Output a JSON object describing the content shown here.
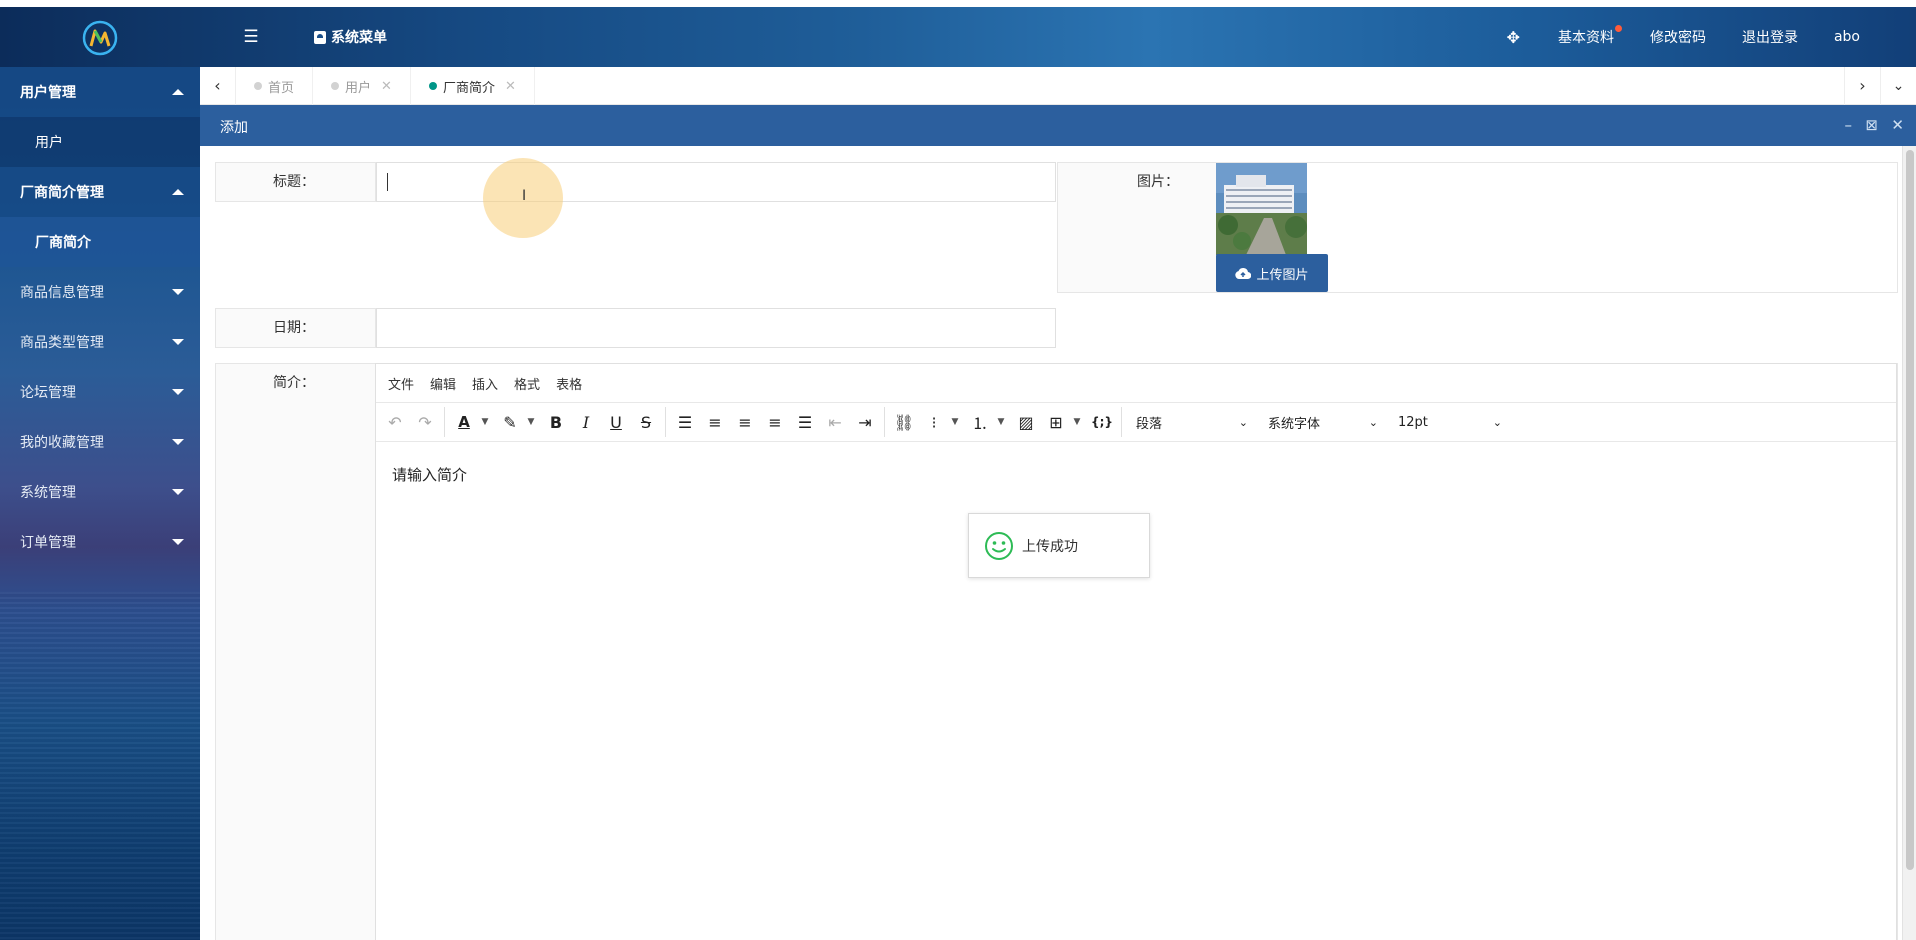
{
  "header": {
    "system_menu_label": "系统菜单",
    "menu_toggle_icon": "list-indent-icon",
    "right_items": [
      {
        "label": "",
        "icon": "fullscreen-icon"
      },
      {
        "label": "基本资料",
        "badge_color": "#ff5b3a"
      },
      {
        "label": "修改密码"
      },
      {
        "label": "退出登录"
      },
      {
        "label": "abo"
      }
    ]
  },
  "sidebar": {
    "items": [
      {
        "label": "用户管理",
        "state": "open"
      },
      {
        "label": "用户",
        "type": "sub"
      },
      {
        "label": "厂商简介管理",
        "state": "open"
      },
      {
        "label": "厂商简介",
        "type": "sub",
        "active": true
      },
      {
        "label": "商品信息管理",
        "state": "closed"
      },
      {
        "label": "商品类型管理",
        "state": "closed"
      },
      {
        "label": "论坛管理",
        "state": "closed"
      },
      {
        "label": "我的收藏管理",
        "state": "closed"
      },
      {
        "label": "系统管理",
        "state": "closed"
      },
      {
        "label": "订单管理",
        "state": "closed"
      }
    ]
  },
  "tabs": [
    {
      "label": "首页",
      "closable": false,
      "active": false
    },
    {
      "label": "用户",
      "closable": true,
      "active": false
    },
    {
      "label": "厂商简介",
      "closable": true,
      "active": true
    }
  ],
  "dialog": {
    "title": "添加"
  },
  "form": {
    "title_label": "标题：",
    "title_value": "",
    "image_label": "图片：",
    "upload_label": "上传图片",
    "date_label": "日期：",
    "date_value": "",
    "intro_label": "简介："
  },
  "editor": {
    "menus": [
      "文件",
      "编辑",
      "插入",
      "格式",
      "表格"
    ],
    "block_format": "段落",
    "font_family": "系统字体",
    "font_size": "12pt",
    "placeholder": "请输入简介"
  },
  "toast": {
    "message": "上传成功",
    "icon": "smile-icon",
    "color": "#2dbb55"
  },
  "colors": {
    "accent": "#2c5f9e",
    "tab_active_dot": "#009688"
  }
}
